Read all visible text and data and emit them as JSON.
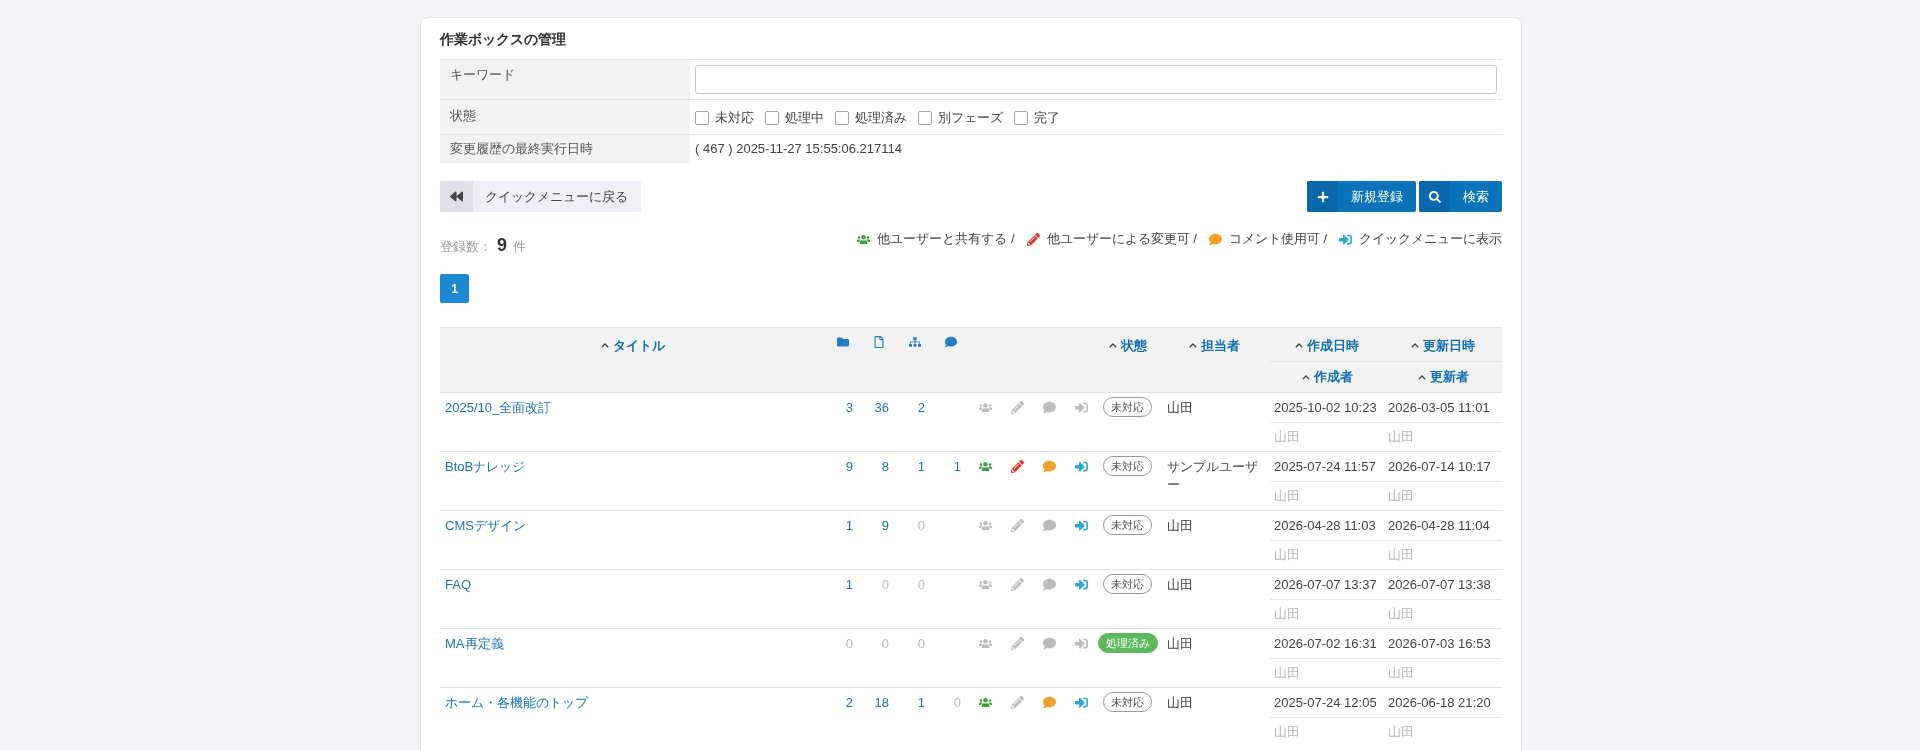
{
  "page": {
    "title": "作業ボックスの管理"
  },
  "filters": {
    "keyword": {
      "label": "キーワード"
    },
    "status": {
      "label": "状態",
      "options": [
        {
          "label": "未対応",
          "checked": false
        },
        {
          "label": "処理中",
          "checked": false
        },
        {
          "label": "処理済み",
          "checked": false
        },
        {
          "label": "別フェーズ",
          "checked": false
        },
        {
          "label": "完了",
          "checked": false
        }
      ]
    },
    "last_run": {
      "label": "変更履歴の最終実行日時",
      "value": "( 467 ) 2025-11-27 15:55:06.217114"
    }
  },
  "toolbar": {
    "back_button": "クイックメニューに戻る",
    "new_button": "新規登録",
    "search_button": "検索"
  },
  "summary": {
    "count_label": "登録数：",
    "count": "9",
    "count_unit": "件"
  },
  "legend": [
    {
      "kind": "shared",
      "text": "他ユーザーと共有する /"
    },
    {
      "kind": "editable",
      "text": "他ユーザーによる変更可 /"
    },
    {
      "kind": "commentable",
      "text": "コメント使用可 /"
    },
    {
      "kind": "on_quick_menu",
      "text": "クイックメニューに表示"
    }
  ],
  "pagination": [
    {
      "label": "1",
      "selected": true
    }
  ],
  "table": {
    "columns": {
      "title": "タイトル",
      "status": "状態",
      "assignee": "担当者",
      "created_at": "作成日時",
      "updated_at": "更新日時",
      "created_by": "作成者",
      "updated_by": "更新者"
    },
    "rows": [
      {
        "title": "2025/10_全面改訂",
        "folder_count": {
          "text": "3",
          "disabled": false
        },
        "file_count": {
          "text": "36",
          "disabled": false
        },
        "tree_count": {
          "text": "2",
          "disabled": false
        },
        "shared": false,
        "editable": false,
        "commentable": false,
        "on_quick_menu": false,
        "status": {
          "kind": "open",
          "text": "未対応"
        },
        "assignee": "山田",
        "created_at": "2025-10-02 10:23",
        "updated_at": "2026-03-05 11:01",
        "created_by": "山田",
        "updated_by": "山田"
      },
      {
        "title": "BtoBナレッジ",
        "folder_count": {
          "text": "9",
          "disabled": false
        },
        "file_count": {
          "text": "8",
          "disabled": false
        },
        "tree_count": {
          "text": "1",
          "disabled": false
        },
        "comment_count": {
          "text": "1",
          "disabled": false
        },
        "shared": true,
        "editable": true,
        "commentable": true,
        "on_quick_menu": true,
        "status": {
          "kind": "open",
          "text": "未対応"
        },
        "assignee": "サンプルユーザー",
        "created_at": "2025-07-24 11:57",
        "updated_at": "2026-07-14 10:17",
        "created_by": "山田",
        "updated_by": "山田"
      },
      {
        "title": "CMSデザイン",
        "folder_count": {
          "text": "1",
          "disabled": false
        },
        "file_count": {
          "text": "9",
          "disabled": false
        },
        "tree_count": {
          "text": "0",
          "disabled": true
        },
        "shared": false,
        "editable": false,
        "commentable": false,
        "on_quick_menu": true,
        "status": {
          "kind": "open",
          "text": "未対応"
        },
        "assignee": "山田",
        "created_at": "2026-04-28 11:03",
        "updated_at": "2026-04-28 11:04",
        "created_by": "山田",
        "updated_by": "山田"
      },
      {
        "title": "FAQ",
        "folder_count": {
          "text": "1",
          "disabled": false
        },
        "file_count": {
          "text": "0",
          "disabled": true
        },
        "tree_count": {
          "text": "0",
          "disabled": true
        },
        "shared": false,
        "editable": false,
        "commentable": false,
        "on_quick_menu": true,
        "status": {
          "kind": "open",
          "text": "未対応"
        },
        "assignee": "山田",
        "created_at": "2026-07-07 13:37",
        "updated_at": "2026-07-07 13:38",
        "created_by": "山田",
        "updated_by": "山田"
      },
      {
        "title": "MA再定義",
        "folder_count": {
          "text": "0",
          "disabled": true
        },
        "file_count": {
          "text": "0",
          "disabled": true
        },
        "tree_count": {
          "text": "0",
          "disabled": true
        },
        "shared": false,
        "editable": false,
        "commentable": false,
        "on_quick_menu": false,
        "status": {
          "kind": "done",
          "text": "処理済み"
        },
        "assignee": "山田",
        "created_at": "2026-07-02 16:31",
        "updated_at": "2026-07-03 16:53",
        "created_by": "山田",
        "updated_by": "山田"
      },
      {
        "title": "ホーム・各機能のトップ",
        "folder_count": {
          "text": "2",
          "disabled": false
        },
        "file_count": {
          "text": "18",
          "disabled": false
        },
        "tree_count": {
          "text": "1",
          "disabled": false
        },
        "comment_count": {
          "text": "0",
          "disabled": true
        },
        "shared": true,
        "editable": false,
        "commentable": true,
        "on_quick_menu": true,
        "status": {
          "kind": "open",
          "text": "未対応"
        },
        "assignee": "山田",
        "created_at": "2025-07-24 12:05",
        "updated_at": "2026-06-18 21:20",
        "created_by": "山田",
        "updated_by": "山田"
      }
    ]
  }
}
